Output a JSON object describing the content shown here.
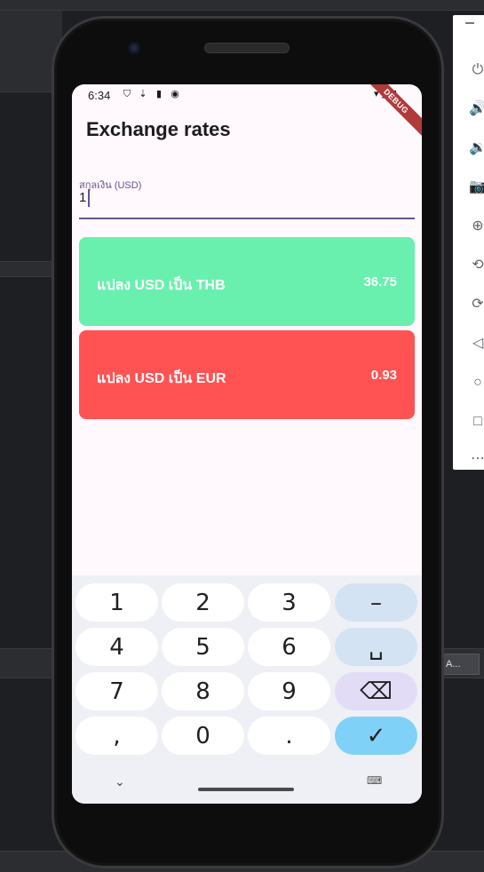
{
  "emulator": {
    "toolbar_icons": [
      "power-icon",
      "volume-up-icon",
      "volume-down-icon",
      "camera-icon",
      "zoom-icon",
      "rotate-left-icon",
      "rotate-right-icon",
      "back-icon",
      "home-icon",
      "overview-icon",
      "more-icon"
    ],
    "ide_chip_text": "A..."
  },
  "status_bar": {
    "time": "6:34"
  },
  "debug_banner": "DEBUG",
  "app_bar": {
    "title": "Exchange rates"
  },
  "amount_field": {
    "label": "สกุลเงิน (USD)",
    "value": "1"
  },
  "conversions": [
    {
      "label": "แปลง USD เป็น THB",
      "value": "36.75",
      "color": "#69f0ae"
    },
    {
      "label": "แปลง USD เป็น EUR",
      "value": "0.93",
      "color": "#ff5252"
    }
  ],
  "keyboard": {
    "row1": [
      "1",
      "2",
      "3",
      "–"
    ],
    "row2": [
      "4",
      "5",
      "6",
      "␣"
    ],
    "row3": [
      "7",
      "8",
      "9",
      "⌫"
    ],
    "row4": [
      ",",
      "0",
      ".",
      "✓"
    ]
  },
  "colors": {
    "primary": "#65558f",
    "screen_bg": "#fff8fc",
    "keyboard_bg": "#eef0f5",
    "key_fn": "#d3e3f4",
    "key_ok": "#7fd1f7"
  }
}
